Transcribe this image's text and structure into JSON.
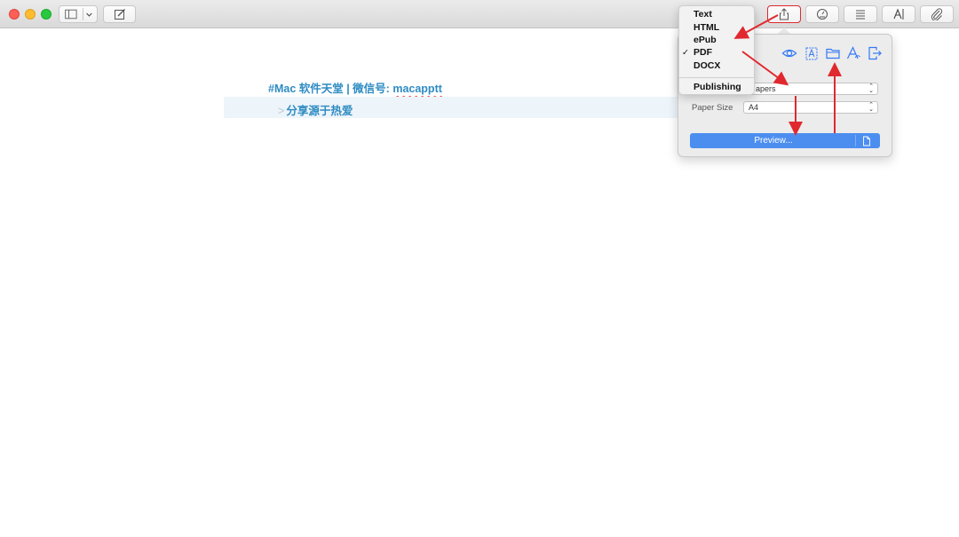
{
  "editor": {
    "heading_prefix": "#Mac 软件天堂 | 微信号: ",
    "heading_handle": "macapptt",
    "quote_marker": ">",
    "quote_text": "分享源于热爱"
  },
  "export_menu": {
    "items": [
      "Text",
      "HTML",
      "ePub",
      "PDF",
      "DOCX"
    ],
    "selected": "PDF",
    "check_mark": "✓",
    "publishing_label": "Publishing"
  },
  "export_panel": {
    "style_value_visible": "apers",
    "paper_size_label": "Paper Size",
    "paper_size_value": "A4",
    "preview_label": "Preview..."
  },
  "icons": {
    "toolbar": [
      "sidebar-icon",
      "chevron-down-icon",
      "compose-icon",
      "share-icon",
      "stats-icon",
      "list-icon",
      "font-icon",
      "paperclip-icon"
    ],
    "export_panel": [
      "eye-icon",
      "text-box-icon",
      "folder-icon",
      "font-style-icon",
      "export-icon",
      "document-icon"
    ]
  },
  "colors": {
    "accent_blue": "#2f8cc3",
    "button_blue": "#4c8ef0",
    "annotation_red": "#e0292f"
  }
}
